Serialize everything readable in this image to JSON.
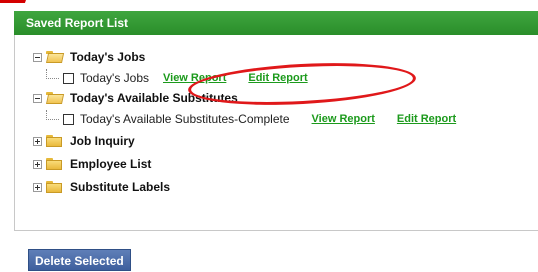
{
  "header": {
    "title": "Saved Report List"
  },
  "tree": [
    {
      "label": "Today's Jobs",
      "expanded": true,
      "items": [
        {
          "label": "Today's Jobs",
          "view": "View Report",
          "edit": "Edit Report"
        }
      ]
    },
    {
      "label": "Today's Available Substitutes",
      "expanded": true,
      "items": [
        {
          "label": "Today's Available Substitutes-Complete",
          "view": "View Report",
          "edit": "Edit Report"
        }
      ]
    },
    {
      "label": "Job Inquiry",
      "expanded": false
    },
    {
      "label": "Employee List",
      "expanded": false
    },
    {
      "label": "Substitute Labels",
      "expanded": false
    }
  ],
  "actions": {
    "delete_label": "Delete Selected"
  },
  "colors": {
    "header_green": "#2a8e2a",
    "link_green": "#1c9a1c",
    "button_blue": "#3e5f9d",
    "annotation_red": "#e0181a"
  }
}
